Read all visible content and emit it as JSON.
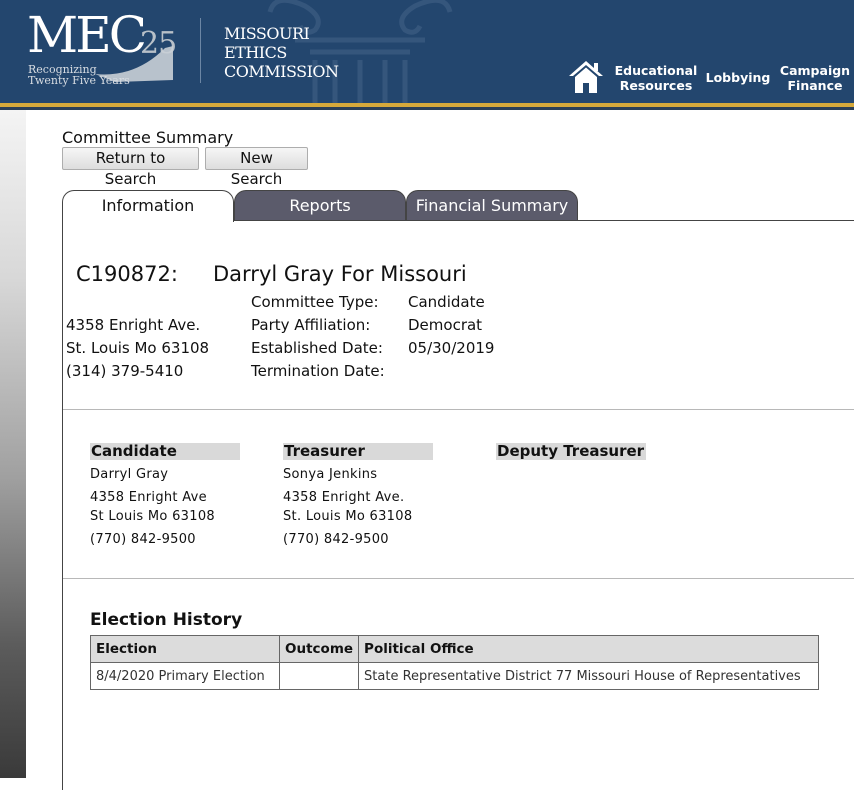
{
  "header": {
    "logo_text": "MEC",
    "logo_number": "25",
    "logo_tagline": [
      "Recognizing",
      "Twenty Five Years"
    ],
    "org_name": [
      "MISSOURI",
      "ETHICS",
      "COMMISSION"
    ],
    "nav": {
      "educational": [
        "Educational",
        "Resources"
      ],
      "lobbying": "Lobbying",
      "campaign": [
        "Campaign",
        "Finance"
      ]
    },
    "colors": {
      "background": "#23466e",
      "accent": "#d6a93b"
    }
  },
  "page": {
    "heading": "Committee Summary",
    "buttons": {
      "return": "Return to Search",
      "new": "New Search"
    },
    "tabs": [
      "Information",
      "Reports",
      "Financial Summary"
    ],
    "active_tab": "Information"
  },
  "committee": {
    "id": "C190872:",
    "name": "Darryl Gray For Missouri",
    "address": [
      "4358 Enright Ave.",
      "St. Louis Mo 63108",
      "(314) 379-5410"
    ],
    "fields": [
      {
        "label": "Committee Type:",
        "value": "Candidate"
      },
      {
        "label": "Party Affiliation:",
        "value": "Democrat"
      },
      {
        "label": "Established Date:",
        "value": "05/30/2019"
      },
      {
        "label": "Termination Date:",
        "value": ""
      }
    ]
  },
  "contacts": {
    "candidate": {
      "heading": "Candidate",
      "name": "Darryl Gray",
      "street": "4358 Enright Ave",
      "city": "St Louis Mo 63108",
      "phone": "(770) 842-9500"
    },
    "treasurer": {
      "heading": "Treasurer",
      "name": "Sonya Jenkins",
      "street": "4358 Enright Ave.",
      "city": "St. Louis Mo 63108",
      "phone": "(770) 842-9500"
    },
    "deputy": {
      "heading": "Deputy Treasurer"
    }
  },
  "election_history": {
    "title": "Election History",
    "columns": [
      "Election",
      "Outcome",
      "Political Office"
    ],
    "rows": [
      {
        "election": "8/4/2020 Primary Election",
        "outcome": "",
        "office": "State Representative District 77 Missouri House of Representatives"
      }
    ]
  }
}
